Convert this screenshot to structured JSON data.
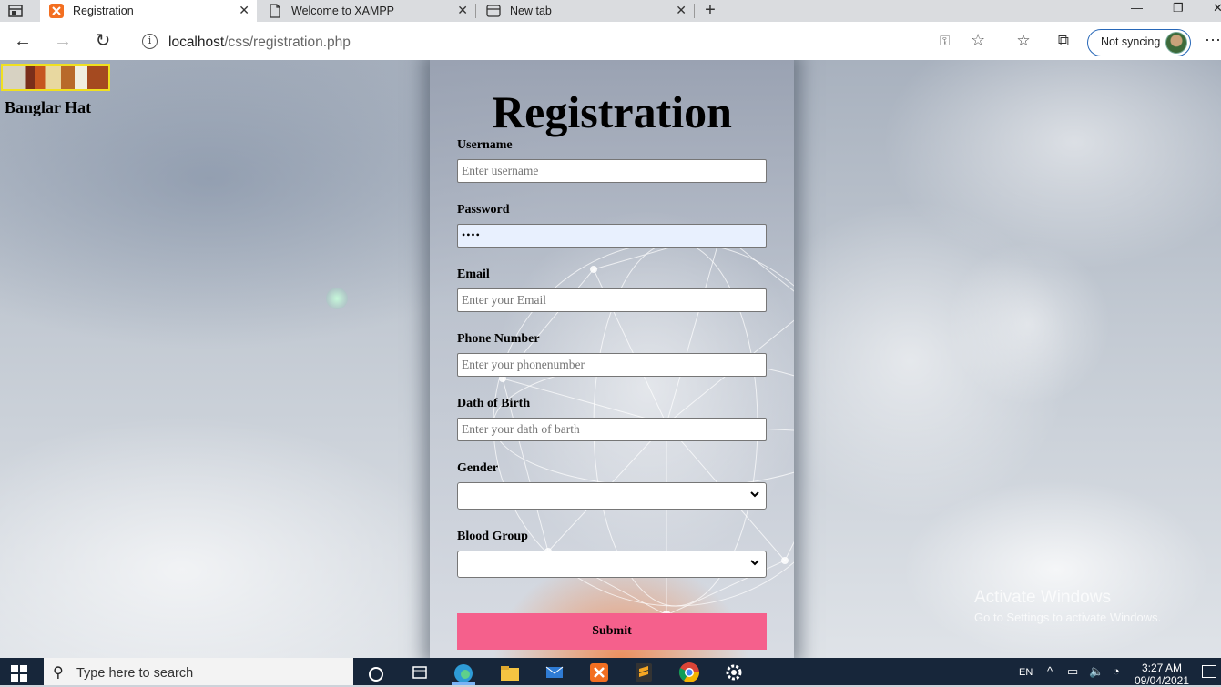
{
  "browser": {
    "tabs": [
      {
        "title": "Registration",
        "active": true
      },
      {
        "title": "Welcome to XAMPP",
        "active": false
      },
      {
        "title": "New tab",
        "active": false
      }
    ],
    "address": {
      "host": "localhost",
      "path": "/css/registration.php"
    },
    "profile_label": "Not syncing"
  },
  "site": {
    "brand": "Banglar Hat"
  },
  "form": {
    "title": "Registration",
    "fields": [
      {
        "label": "Username",
        "placeholder": "Enter username",
        "value": ""
      },
      {
        "label": "Password",
        "placeholder": "",
        "value": "••••"
      },
      {
        "label": "Email",
        "placeholder": "Enter your Email",
        "value": ""
      },
      {
        "label": "Phone Number",
        "placeholder": "Enter your phonenumber",
        "value": ""
      },
      {
        "label": "Dath of Birth",
        "placeholder": "Enter your dath of barth",
        "value": ""
      }
    ],
    "selects": [
      {
        "label": "Gender",
        "value": ""
      },
      {
        "label": "Blood Group",
        "value": ""
      }
    ],
    "submit_label": "Submit",
    "accent_color": "#f5608c"
  },
  "watermark": {
    "title": "Activate Windows",
    "subtitle": "Go to Settings to activate Windows."
  },
  "taskbar": {
    "search_placeholder": "Type here to search",
    "language": "EN",
    "time": "3:27 AM",
    "date": "09/04/2021"
  }
}
